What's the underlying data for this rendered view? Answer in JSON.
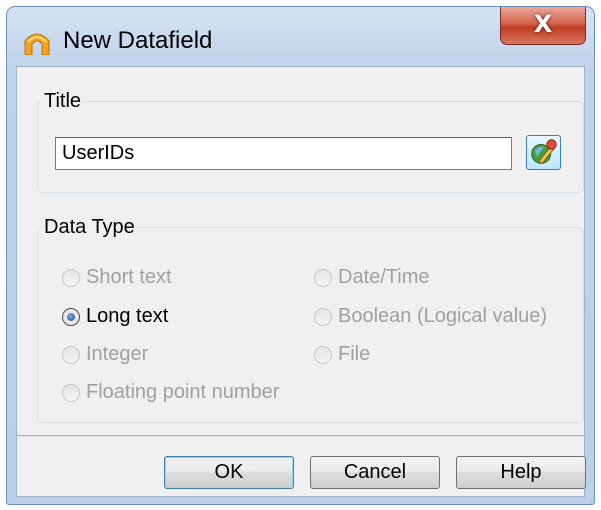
{
  "window": {
    "title": "New Datafield",
    "close_label": "X"
  },
  "title_group": {
    "legend": "Title",
    "value": "UserIDs"
  },
  "data_type_group": {
    "legend": "Data Type",
    "selected": "long_text",
    "options": {
      "short_text": "Short text",
      "long_text": "Long text",
      "integer": "Integer",
      "floating_point": "Floating point number",
      "date_time": "Date/Time",
      "boolean": "Boolean (Logical value)",
      "file": "File"
    }
  },
  "buttons": {
    "ok": "OK",
    "cancel": "Cancel",
    "help": "Help"
  }
}
